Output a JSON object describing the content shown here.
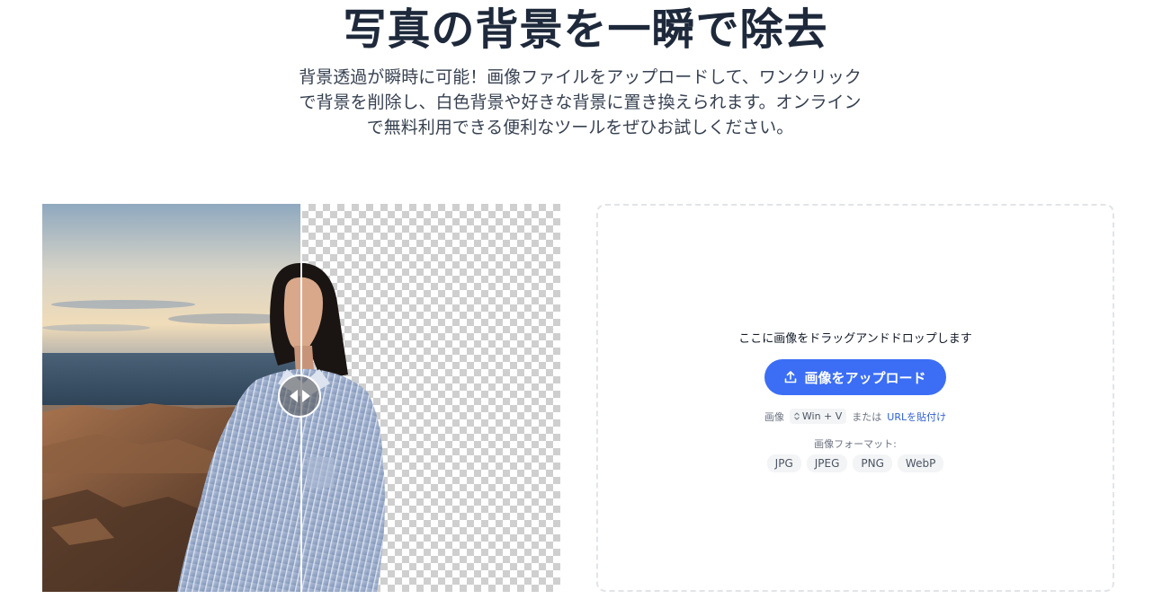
{
  "hero": {
    "title": "写真の背景を一瞬で除去",
    "subtitle_lines": [
      "背景透過が瞬時に可能！画像ファイルをアップロードして、ワンクリック",
      "で背景を削除し、白色背景や好きな背景に置き換えられます。オンライン",
      "で無料利用できる便利なツールをぜひお試しください。"
    ]
  },
  "preview": {
    "slider_icon": "left-right-arrows-icon",
    "split_position": 0.5
  },
  "upload": {
    "drop_text": "ここに画像をドラッグアンドドロップします",
    "button_label": "画像をアップロード",
    "button_icon": "upload-icon",
    "button_color": "#3b6ef5",
    "paste_prefix": "画像",
    "paste_shortcut": "Win + V",
    "paste_or": "または",
    "url_link": "URLを貼付け",
    "formats_label": "画像フォーマット:",
    "formats": [
      "JPG",
      "JPEG",
      "PNG",
      "WebP"
    ]
  }
}
